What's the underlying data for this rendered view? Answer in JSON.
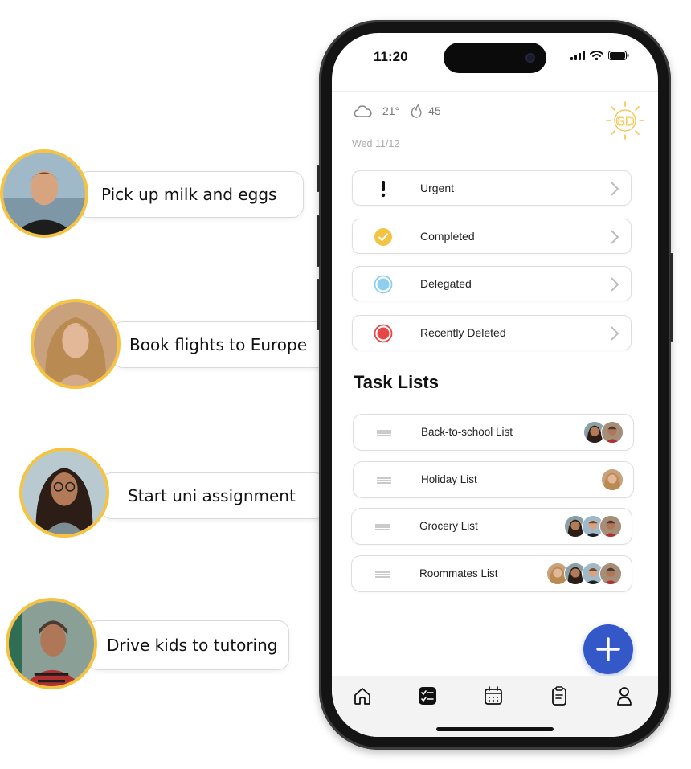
{
  "callouts": [
    {
      "text": "Pick up milk and eggs",
      "avatar": "young-man-avatar"
    },
    {
      "text": "Book flights to Europe",
      "avatar": "blonde-woman-avatar"
    },
    {
      "text": "Start uni assignment",
      "avatar": "woman-glasses-avatar"
    },
    {
      "text": "Drive kids to tutoring",
      "avatar": "man-beanie-avatar"
    }
  ],
  "status": {
    "time": "11:20"
  },
  "weather": {
    "icon": "cloud-icon",
    "temperature": "21°",
    "flame_icon": "flame-icon",
    "streak": "45"
  },
  "date": "Wed 11/12",
  "logo": {
    "text": "GD",
    "icon": "sun-logo-icon",
    "color": "#f5c342"
  },
  "categories": [
    {
      "label": "Urgent",
      "icon": "exclamation-icon"
    },
    {
      "label": "Completed",
      "icon": "check-circle-icon",
      "color": "#f5c342"
    },
    {
      "label": "Delegated",
      "icon": "blue-circle-icon",
      "color": "#8ecff0"
    },
    {
      "label": "Recently Deleted",
      "icon": "red-circle-icon",
      "color": "#e84545"
    }
  ],
  "task_lists_title": "Task Lists",
  "task_lists": [
    {
      "label": "Back-to-school List",
      "member_count": 2
    },
    {
      "label": "Holiday List",
      "member_count": 1
    },
    {
      "label": "Grocery List",
      "member_count": 3
    },
    {
      "label": "Roommates List",
      "member_count": 4
    }
  ],
  "fab": {
    "icon": "plus-icon",
    "color": "#3558c9"
  },
  "tabbar": [
    {
      "name": "home-icon"
    },
    {
      "name": "tasks-icon",
      "active": true
    },
    {
      "name": "calendar-icon"
    },
    {
      "name": "clipboard-icon"
    },
    {
      "name": "profile-icon"
    }
  ]
}
